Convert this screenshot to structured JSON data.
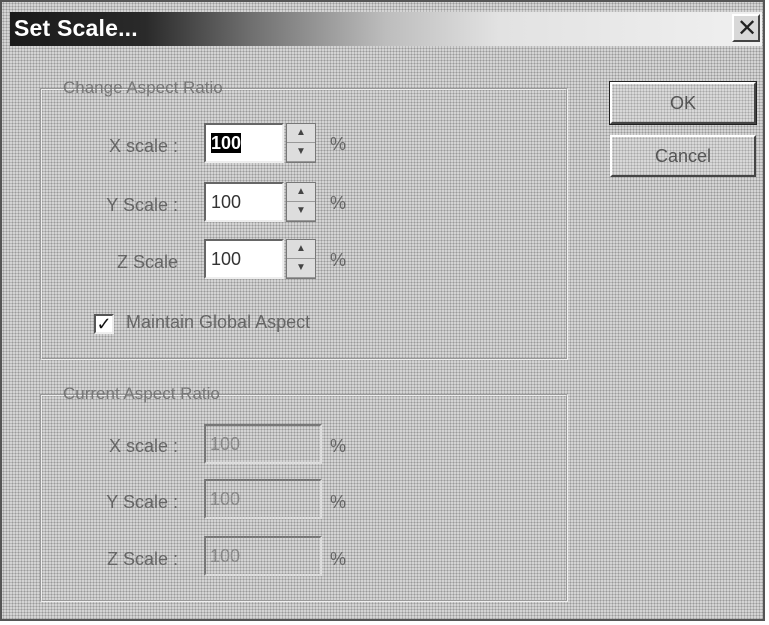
{
  "window": {
    "title": "Set Scale...",
    "close_icon": "close-icon"
  },
  "buttons": {
    "ok": "OK",
    "cancel": "Cancel"
  },
  "change_group": {
    "legend": "Change Aspect Ratio",
    "x": {
      "label": "X scale :",
      "value": "100",
      "unit": "%"
    },
    "y": {
      "label": "Y Scale :",
      "value": "100",
      "unit": "%"
    },
    "z": {
      "label": "Z Scale",
      "value": "100",
      "unit": "%"
    },
    "maintain": {
      "label": "Maintain Global Aspect",
      "checked": true
    }
  },
  "current_group": {
    "legend": "Current Aspect Ratio",
    "x": {
      "label": "X scale :",
      "value": "100",
      "unit": "%"
    },
    "y": {
      "label": "Y Scale :",
      "value": "100",
      "unit": "%"
    },
    "z": {
      "label": "Z Scale :",
      "value": "100",
      "unit": "%"
    }
  }
}
